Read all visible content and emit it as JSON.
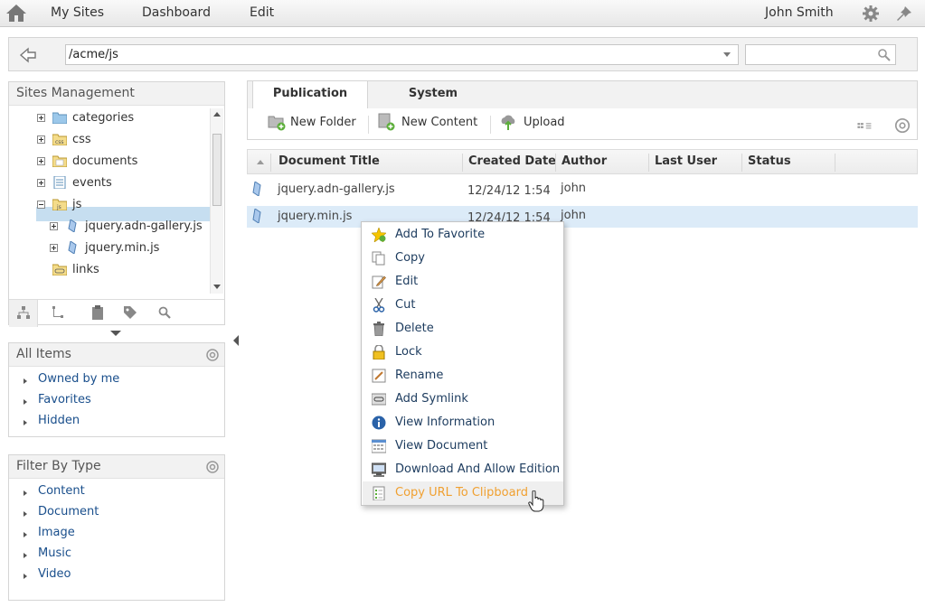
{
  "topbar": {
    "nav": [
      "My Sites",
      "Dashboard",
      "Edit"
    ],
    "user": "John Smith",
    "icons": [
      "home-icon",
      "gear-icon",
      "pin-icon"
    ]
  },
  "address": {
    "path": "/acme/js",
    "search_placeholder": ""
  },
  "sites_panel": {
    "title": "Sites Management",
    "tree": [
      {
        "label": "categories",
        "icon": "folder-icon"
      },
      {
        "label": "css",
        "icon": "css-folder-icon"
      },
      {
        "label": "documents",
        "icon": "documents-folder-icon"
      },
      {
        "label": "events",
        "icon": "events-icon"
      },
      {
        "label": "js",
        "icon": "js-folder-icon",
        "selected": true
      },
      {
        "label": "jquery.adn-gallery.js",
        "icon": "js-file-icon"
      },
      {
        "label": "jquery.min.js",
        "icon": "js-file-icon"
      },
      {
        "label": "links",
        "icon": "links-folder-icon"
      }
    ]
  },
  "all_items": {
    "title": "All Items",
    "items": [
      "Owned by me",
      "Favorites",
      "Hidden"
    ]
  },
  "filter_by_type": {
    "title": "Filter By Type",
    "items": [
      "Content",
      "Document",
      "Image",
      "Music",
      "Video"
    ]
  },
  "tabs": [
    "Publication",
    "System"
  ],
  "toolbar": {
    "new_folder": "New Folder",
    "new_content": "New Content",
    "upload": "Upload"
  },
  "grid": {
    "columns": [
      "Document Title",
      "Created Date",
      "Author",
      "Last User",
      "Status"
    ],
    "rows": [
      {
        "title": "jquery.adn-gallery.js",
        "created": "12/24/12 1:54",
        "author": "john",
        "last_user": "",
        "status": ""
      },
      {
        "title": "jquery.min.js",
        "created": "12/24/12 1:54",
        "author": "john",
        "last_user": "",
        "status": ""
      }
    ]
  },
  "context_menu": [
    {
      "label": "Add To Favorite",
      "icon": "star-icon"
    },
    {
      "label": "Copy",
      "icon": "copy-icon"
    },
    {
      "label": "Edit",
      "icon": "edit-icon"
    },
    {
      "label": "Cut",
      "icon": "scissors-icon"
    },
    {
      "label": "Delete",
      "icon": "trash-icon"
    },
    {
      "label": "Lock",
      "icon": "lock-icon"
    },
    {
      "label": "Rename",
      "icon": "rename-icon"
    },
    {
      "label": "Add Symlink",
      "icon": "symlink-icon"
    },
    {
      "label": "View Information",
      "icon": "info-icon"
    },
    {
      "label": "View Document",
      "icon": "view-document-icon"
    },
    {
      "label": "Download And Allow Edition",
      "icon": "download-icon"
    },
    {
      "label": "Copy URL To Clipboard",
      "icon": "clipboard-icon",
      "hovered": true
    }
  ],
  "colors": {
    "accent_hover": "#f0a030",
    "selection": "#dcebf8",
    "link": "#1a4f8c"
  }
}
